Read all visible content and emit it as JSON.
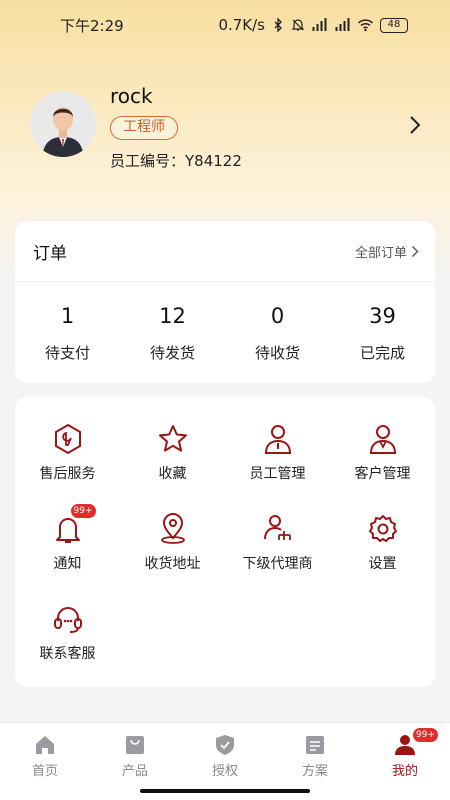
{
  "status_bar": {
    "time": "下午2:29",
    "net_speed": "0.7K/s",
    "battery": "48"
  },
  "profile": {
    "username": "rock",
    "role": "工程师",
    "employee_id": "员工编号：Y84122"
  },
  "orders": {
    "title": "订单",
    "all_orders_link": "全部订单",
    "stats": [
      {
        "count": "1",
        "label": "待支付"
      },
      {
        "count": "12",
        "label": "待发货"
      },
      {
        "count": "0",
        "label": "待收货"
      },
      {
        "count": "39",
        "label": "已完成"
      }
    ]
  },
  "services": {
    "items": [
      {
        "label": "售后服务",
        "icon": "after-sales-icon"
      },
      {
        "label": "收藏",
        "icon": "star-icon"
      },
      {
        "label": "员工管理",
        "icon": "employee-icon"
      },
      {
        "label": "客户管理",
        "icon": "customer-icon"
      },
      {
        "label": "通知",
        "icon": "bell-icon",
        "badge": "99+"
      },
      {
        "label": "收货地址",
        "icon": "location-icon"
      },
      {
        "label": "下级代理商",
        "icon": "org-icon"
      },
      {
        "label": "设置",
        "icon": "gear-icon"
      },
      {
        "label": "联系客服",
        "icon": "headset-icon"
      }
    ]
  },
  "tabs": [
    {
      "label": "首页",
      "icon": "home-icon"
    },
    {
      "label": "产品",
      "icon": "bag-icon"
    },
    {
      "label": "授权",
      "icon": "shield-icon"
    },
    {
      "label": "方案",
      "icon": "document-icon"
    },
    {
      "label": "我的",
      "icon": "user-icon",
      "badge": "99+",
      "active": true
    }
  ],
  "colors": {
    "accent": "#9b1515",
    "badge": "#e32b2b",
    "role_badge": "#d3703a"
  }
}
